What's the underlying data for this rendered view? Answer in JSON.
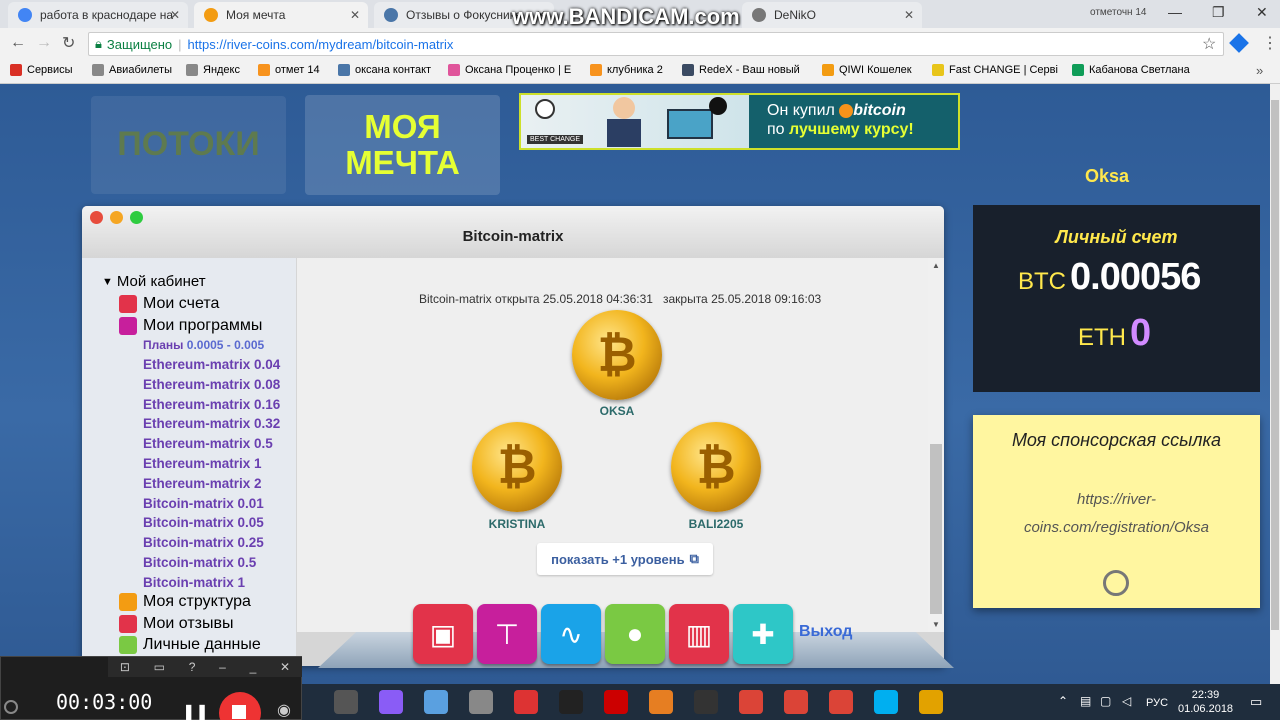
{
  "browser": {
    "tabs": [
      {
        "label": "работа в краснодаре на",
        "icon": "google-icon",
        "color": "#4285f4"
      },
      {
        "label": "Моя мечта",
        "icon": "river-coins-icon",
        "color": "#f39c12",
        "active": true
      },
      {
        "label": "Отзывы о Фокуснике",
        "icon": "vk-icon",
        "color": "#4a76a8"
      },
      {
        "label": "DeNikO",
        "icon": "page-icon",
        "color": "#777"
      }
    ],
    "overlay_watermark": "www.BANDICAM.com",
    "profile_label": "отметочн 14",
    "security_label": "Защищено",
    "url": "https://river-coins.com/mydream/bitcoin-matrix",
    "bookmarks": [
      {
        "label": "Сервисы",
        "icon": "apps-icon",
        "color": "#d93025"
      },
      {
        "label": "Авиабилеты",
        "icon": "page-icon",
        "color": "#888"
      },
      {
        "label": "Яндекс",
        "icon": "page-icon",
        "color": "#888"
      },
      {
        "label": "отмет 14",
        "icon": "ok-icon",
        "color": "#f7931e"
      },
      {
        "label": "оксана контакт",
        "icon": "chat-icon",
        "color": "#4a76a8"
      },
      {
        "label": "Оксана Проценко | Е",
        "icon": "loop-icon",
        "color": "#e0559b"
      },
      {
        "label": "клубника 2",
        "icon": "ok-icon",
        "color": "#f7931e"
      },
      {
        "label": "RedeX - Ваш новый",
        "icon": "redex-icon",
        "color": "#3b4b63"
      },
      {
        "label": "QIWI Кошелек",
        "icon": "qiwi-icon",
        "color": "#f39c12"
      },
      {
        "label": "Fast CHANGE | Серві",
        "icon": "fastchange-icon",
        "color": "#e8c51a"
      },
      {
        "label": "Кабанова Светлана",
        "icon": "sheet-icon",
        "color": "#0f9d58"
      }
    ]
  },
  "site": {
    "nav": {
      "potoki": "ПОТОКИ",
      "mechta_line1": "МОЯ",
      "mechta_line2": "МЕЧТА"
    },
    "banner": {
      "brand": "BEST CHANGE",
      "line1_pre": "Он купил",
      "line1_coin": "bitcoin",
      "line2_pre": "по",
      "line2_accent": "лучшему курсу!"
    },
    "username": "Oksa",
    "window": {
      "title": "Bitcoin-matrix"
    },
    "sidebar": {
      "cabinet": "Мой кабинет",
      "items": [
        {
          "label": "Мои счета",
          "color": "#e2334a"
        },
        {
          "label": "Мои программы",
          "color": "#c71f9c"
        }
      ],
      "plans_label": "Планы",
      "plans_range": "0.0005 - 0.005",
      "plans": [
        "Ethereum-matrix 0.04",
        "Ethereum-matrix 0.08",
        "Ethereum-matrix 0.16",
        "Ethereum-matrix 0.32",
        "Ethereum-matrix 0.5",
        "Ethereum-matrix 1",
        "Ethereum-matrix 2",
        "Bitcoin-matrix 0.01",
        "Bitcoin-matrix 0.05",
        "Bitcoin-matrix 0.25",
        "Bitcoin-matrix 0.5",
        "Bitcoin-matrix 1"
      ],
      "bottom": [
        {
          "label": "Моя структура",
          "color": "#f39c12"
        },
        {
          "label": "Мои отзывы",
          "color": "#e2334a"
        },
        {
          "label": "Личные данные",
          "color": "#7ac943"
        }
      ]
    },
    "matrix": {
      "opened": "Bitcoin-matrix открыта 25.05.2018 04:36:31",
      "closed": "закрыта 25.05.2018 09:16:03",
      "nodes": [
        "OKSA",
        "KRISTINA",
        "BALI2205"
      ],
      "show_more": "показать +1 уровень"
    },
    "dock": [
      {
        "name": "wallet",
        "color": "#e2334a",
        "glyph": "▣"
      },
      {
        "name": "structure",
        "color": "#c71f9c",
        "glyph": "⊤"
      },
      {
        "name": "chart",
        "color": "#1aa3e8",
        "glyph": "∿"
      },
      {
        "name": "profile",
        "color": "#7ac943",
        "glyph": "●"
      },
      {
        "name": "factory",
        "color": "#e2334a",
        "glyph": "▥"
      },
      {
        "name": "settings",
        "color": "#2ec7c7",
        "glyph": "✚"
      }
    ],
    "logout": "Выход",
    "account": {
      "title": "Личный счет",
      "btc_label": "BTC",
      "btc_value": "0.00056",
      "eth_label": "ETH",
      "eth_value": "0"
    },
    "sponsor": {
      "title": "Моя спонсорская ссылка",
      "link": "https://river-coins.com/registration/Oksa"
    }
  },
  "recorder": {
    "time": "00:03:00"
  },
  "taskbar": {
    "lang": "РУС",
    "time": "22:39",
    "date": "01.06.2018"
  }
}
